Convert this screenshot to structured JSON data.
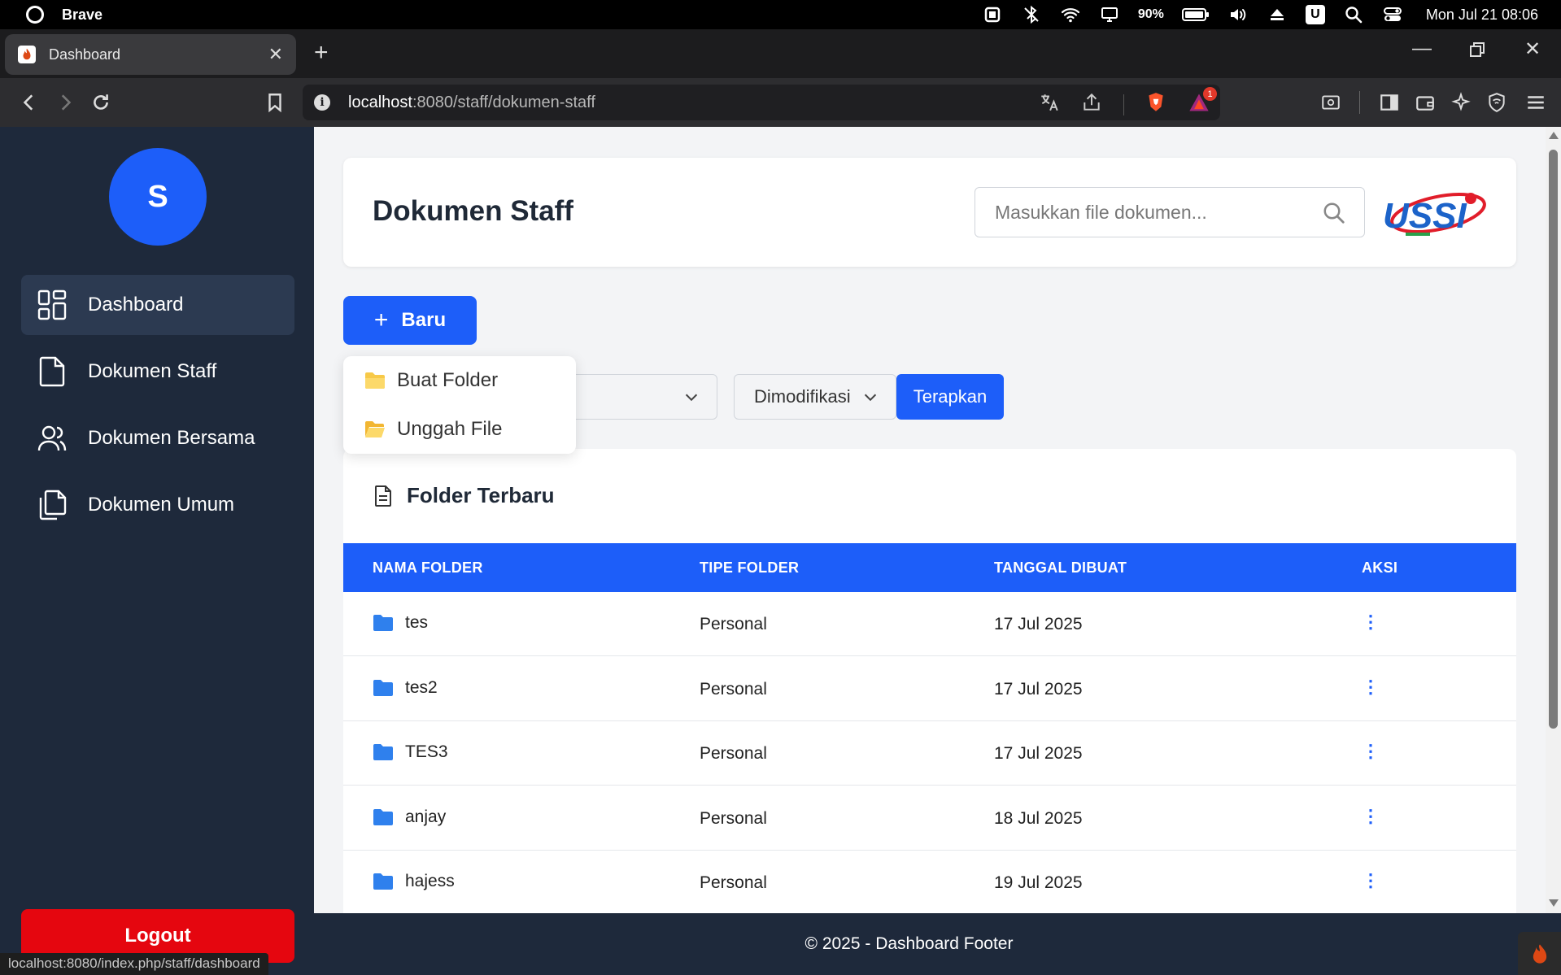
{
  "os": {
    "app_name": "Brave",
    "battery": "90%",
    "clock": "Mon Jul 21 08:06",
    "ubox": "U"
  },
  "browser": {
    "tab_title": "Dashboard",
    "url_host": "localhost",
    "url_path": ":8080/staff/dokumen-staff",
    "notification_count": "1",
    "status_link": "localhost:8080/index.php/staff/dashboard"
  },
  "sidebar": {
    "avatar_letter": "S",
    "items": [
      {
        "label": "Dashboard",
        "icon": "grid-icon",
        "active": true
      },
      {
        "label": "Dokumen Staff",
        "icon": "file-icon",
        "active": false
      },
      {
        "label": "Dokumen Bersama",
        "icon": "users-icon",
        "active": false
      },
      {
        "label": "Dokumen Umum",
        "icon": "copy-icon",
        "active": false
      }
    ],
    "logout_label": "Logout"
  },
  "header": {
    "title": "Dokumen Staff",
    "search_placeholder": "Masukkan file dokumen...",
    "logo_text": "USSI"
  },
  "actions": {
    "new_label": "Baru",
    "dropdown": [
      {
        "label": "Buat Folder",
        "icon": "folder-icon"
      },
      {
        "label": "Unggah File",
        "icon": "folder-open-icon"
      }
    ],
    "sort_label": "Dimodifikasi",
    "apply_label": "Terapkan"
  },
  "table": {
    "title": "Folder Terbaru",
    "headers": [
      "NAMA FOLDER",
      "TIPE FOLDER",
      "TANGGAL DIBUAT",
      "AKSI"
    ],
    "rows": [
      {
        "name": "tes",
        "type": "Personal",
        "date": "17 Jul 2025",
        "action": "⋮"
      },
      {
        "name": "tes2",
        "type": "Personal",
        "date": "17 Jul 2025",
        "action": "⋮"
      },
      {
        "name": "TES3",
        "type": "Personal",
        "date": "17 Jul 2025",
        "action": "⋮"
      },
      {
        "name": "anjay",
        "type": "Personal",
        "date": "18 Jul 2025",
        "action": "⋮"
      },
      {
        "name": "hajess",
        "type": "Personal",
        "date": "19 Jul 2025",
        "action": "⋮"
      }
    ]
  },
  "footer": {
    "text": "© 2025 - Dashboard Footer"
  },
  "colors": {
    "primary": "#1d5ef9",
    "sidebar": "#1e293b",
    "danger": "#e5060f",
    "folder": "#2f80ed"
  }
}
